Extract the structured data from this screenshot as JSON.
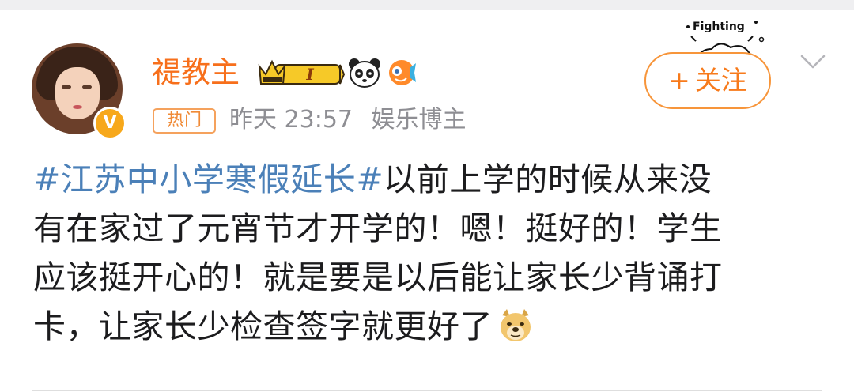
{
  "post": {
    "author": {
      "name": "禔教主",
      "level": "I",
      "verified_badge": "V"
    },
    "hot_tag": "热门",
    "time": "昨天 23:57",
    "author_title": "娱乐博主",
    "follow_button": {
      "plus": "+",
      "label": "关注"
    },
    "decoration_text": "Fighting",
    "content": {
      "topic": "#江苏中小学寒假延长#",
      "line1_rest": "以前上学的时候从来没",
      "line2": "有在家过了元宵节才开学的！嗯！挺好的！学生",
      "line3": "应该挺开心的！就是要是以后能让家长少背诵打",
      "line4": "卡，让家长少检查签字就更好了"
    },
    "icons": {
      "crown": "crown-level-icon",
      "panda": "panda-icon",
      "fish": "fish-icon",
      "doge": "doge-emoji-icon",
      "chevron": "chevron-down-icon"
    },
    "colors": {
      "username": "#f76f1b",
      "topic": "#4b80b8",
      "follow": "#f77a1b",
      "meta": "#8e8e93"
    }
  }
}
